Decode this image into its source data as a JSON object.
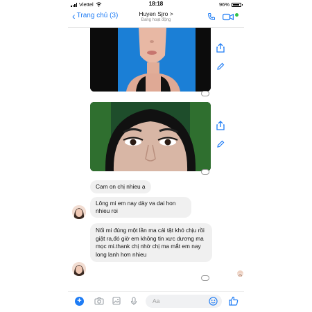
{
  "status_bar": {
    "carrier": "Viettel",
    "time": "18:18",
    "battery": "96%"
  },
  "header": {
    "back_label": "Trang chủ (3)",
    "contact_name": "Huyen Sjro >",
    "contact_status": "Đang hoạt động"
  },
  "messages": [
    {
      "type": "image",
      "content": "face-photo-lower"
    },
    {
      "type": "image",
      "content": "eyes-photo-closeup"
    },
    {
      "type": "text",
      "text": "Cam on chị nhieu ạ"
    },
    {
      "type": "text",
      "text": "Lông mi em nay dày va dai hon nhieu roi"
    },
    {
      "type": "text",
      "text": "Nối mi đúng một lần ma cái tật khó chịu rồi giật ra,đó giờ em không tin xưc dương ma mọc mi.thank chị nhờ chị ma mắt em nay long lanh hơn nhieu"
    }
  ],
  "input": {
    "placeholder": "Aa"
  },
  "colors": {
    "accent": "#1e7cf5",
    "bubble": "#f0f0f0"
  },
  "icons": {
    "back": "chevron-left-icon",
    "call": "phone-icon",
    "video": "video-icon",
    "share": "share-icon",
    "edit": "pencil-icon",
    "add": "plus-icon",
    "camera": "camera-icon",
    "gallery": "image-icon",
    "mic": "microphone-icon",
    "emoji": "emoji-icon",
    "like": "thumbs-up-icon"
  }
}
